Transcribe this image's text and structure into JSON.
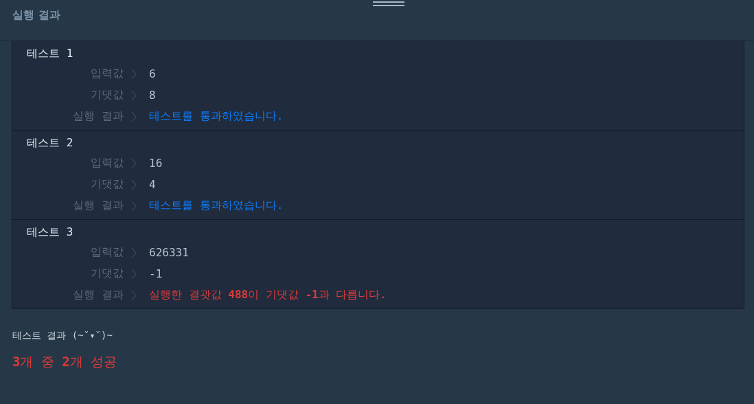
{
  "header": {
    "title": "실행 결과"
  },
  "tests": [
    {
      "title": "테스트 1",
      "rows": [
        {
          "label": "입력값",
          "value": "6"
        },
        {
          "label": "기댓값",
          "value": "8"
        }
      ],
      "result": {
        "label": "실행 결과",
        "kind": "pass",
        "text": "테스트를 통과하였습니다."
      }
    },
    {
      "title": "테스트 2",
      "rows": [
        {
          "label": "입력값",
          "value": "16"
        },
        {
          "label": "기댓값",
          "value": "4"
        }
      ],
      "result": {
        "label": "실행 결과",
        "kind": "pass",
        "text": "테스트를 통과하였습니다."
      }
    },
    {
      "title": "테스트 3",
      "rows": [
        {
          "label": "입력값",
          "value": "626331"
        },
        {
          "label": "기댓값",
          "value": "-1"
        }
      ],
      "result": {
        "label": "실행 결과",
        "kind": "fail",
        "text": "실행한 결괏값 **488**이 기댓값 **-1**과 다릅니다."
      }
    }
  ],
  "summary": {
    "heading": "테스트 결과 (~˘▾˘)~",
    "result": "**3**개 중 **2**개 성공"
  }
}
